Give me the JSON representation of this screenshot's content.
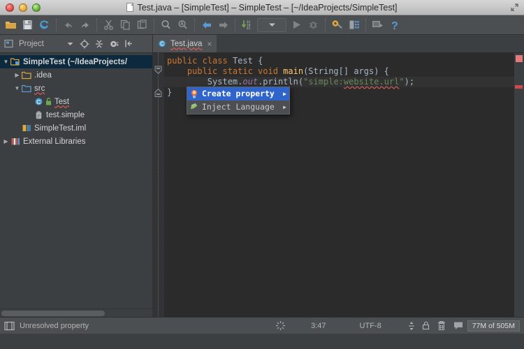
{
  "window": {
    "title": "Test.java – [SimpleTest] – SimpleTest – [~/IdeaProjects/SimpleTest]",
    "doc_icon": "document-icon",
    "expand_icon": "expand-fullscreen-icon",
    "controls": [
      "close-button",
      "minimize-button",
      "zoom-button"
    ]
  },
  "toolbar": {
    "items": [
      {
        "name": "open-project-button",
        "icon": "folder-icon"
      },
      {
        "name": "save-all-button",
        "icon": "floppy-save-icon"
      },
      {
        "name": "sync-refresh-button",
        "icon": "sync-icon"
      },
      {
        "name": "undo-button",
        "icon": "undo-arrow-icon"
      },
      {
        "name": "redo-button",
        "icon": "redo-arrow-icon"
      },
      {
        "name": "cut-button",
        "icon": "scissors-icon"
      },
      {
        "name": "copy-button",
        "icon": "copy-icon"
      },
      {
        "name": "paste-button",
        "icon": "paste-icon"
      },
      {
        "name": "find-button",
        "icon": "magnifier-icon"
      },
      {
        "name": "replace-button",
        "icon": "magnifier-replace-icon"
      },
      {
        "name": "back-button",
        "icon": "arrow-left-icon"
      },
      {
        "name": "forward-button",
        "icon": "arrow-right-icon"
      },
      {
        "name": "compile-button",
        "icon": "compile-down-arrow-icon"
      },
      {
        "name": "run-configuration-selector",
        "icon": "chevron-down-icon"
      },
      {
        "name": "run-button",
        "icon": "play-triangle-icon"
      },
      {
        "name": "debug-button",
        "icon": "bug-icon"
      },
      {
        "name": "settings-button",
        "icon": "gear-wrench-icon"
      },
      {
        "name": "project-structure-button",
        "icon": "project-structure-icon"
      },
      {
        "name": "sdk-manager-button",
        "icon": "sdk-box-icon"
      },
      {
        "name": "help-button",
        "icon": "question-mark-icon"
      }
    ]
  },
  "project_panel": {
    "title": "Project",
    "header_icons": [
      "project-view-icon",
      "chevron-down-icon",
      "locate-target-icon",
      "collapse-all-icon",
      "gear-icon",
      "hide-panel-icon"
    ],
    "tree": [
      {
        "label": "SimpleTest (~/IdeaProjects/",
        "icon": "module-icon",
        "twist": "expanded",
        "depth": 0,
        "bold": true,
        "selected": true
      },
      {
        "label": ".idea",
        "icon": "folder-orange-icon",
        "twist": "collapsed",
        "depth": 1,
        "bold": false,
        "selected": false
      },
      {
        "label": "src",
        "icon": "folder-source-icon",
        "twist": "expanded",
        "depth": 1,
        "bold": false,
        "selected": false,
        "squiggle": true
      },
      {
        "label": "Test",
        "icon": "java-class-icon",
        "twist": "none",
        "depth": 2,
        "bold": false,
        "selected": false,
        "squiggle": true
      },
      {
        "label": "test.simple",
        "icon": "properties-file-icon",
        "twist": "none",
        "depth": 2,
        "bold": false,
        "selected": false
      },
      {
        "label": "SimpleTest.iml",
        "icon": "iml-file-icon",
        "twist": "none",
        "depth": 1,
        "bold": false,
        "selected": false
      },
      {
        "label": "External Libraries",
        "icon": "libraries-icon",
        "twist": "collapsed",
        "depth": 0,
        "bold": false,
        "selected": false
      }
    ]
  },
  "editor": {
    "tab": {
      "label": "Test.java",
      "icon": "java-class-icon",
      "close": "×",
      "error": true
    },
    "code_lines": [
      [
        {
          "t": "public ",
          "c": "kw"
        },
        {
          "t": "class ",
          "c": "kw"
        },
        {
          "t": "Test",
          "c": "cls"
        },
        {
          "t": " {",
          "c": "plain"
        }
      ],
      [
        {
          "t": "    public static void ",
          "c": "kw"
        },
        {
          "t": "main",
          "c": "mth"
        },
        {
          "t": "(String[] args) {",
          "c": "plain"
        }
      ],
      [
        {
          "t": "        System.",
          "c": "plain"
        },
        {
          "t": "out",
          "c": "fld"
        },
        {
          "t": ".println(",
          "c": "plain"
        },
        {
          "t": "\"simple:",
          "c": "str"
        },
        {
          "t": "website.url",
          "c": "str-err"
        },
        {
          "t": "\"",
          "c": "str"
        },
        {
          "t": ");",
          "c": "plain"
        }
      ],
      [
        {
          "t": "}",
          "c": "plain"
        }
      ]
    ],
    "folding": [
      "fold-minus",
      "fold-minus"
    ],
    "marker_bar": {
      "top_indicator": "error-indicator",
      "markers": [
        "error-stripe"
      ]
    }
  },
  "popup": {
    "items": [
      {
        "label": "Create property",
        "icon": "lightbulb-icon",
        "arrow": "▶",
        "selected": true
      },
      {
        "label": "Inject Language",
        "icon": "inject-pencil-icon",
        "arrow": "▶",
        "selected": false
      }
    ]
  },
  "statusbar": {
    "layout_icon": "toggle-layout-icon",
    "message": "Unresolved property",
    "spinner_icon": "background-task-spinner-icon",
    "caret_position": "3:47",
    "encoding": "UTF-8",
    "line_separator_icon": "line-separator-icon",
    "lock_icon": "read-only-lock-icon",
    "hector_icon": "hector-inspection-icon",
    "event_log_icon": "event-log-icon",
    "memory": "77M of 505M"
  },
  "colors": {
    "chrome": "#4c4f51",
    "panel": "#3c3f41",
    "editor_bg": "#2b2b2b",
    "accent_blue": "#2f65ca",
    "selection_blue": "#0d293e",
    "error_red": "#cf4b4b",
    "keyword_orange": "#cc7832",
    "string_green": "#6a8759",
    "field_purple": "#9876aa",
    "method_yellow": "#ffc66d"
  }
}
